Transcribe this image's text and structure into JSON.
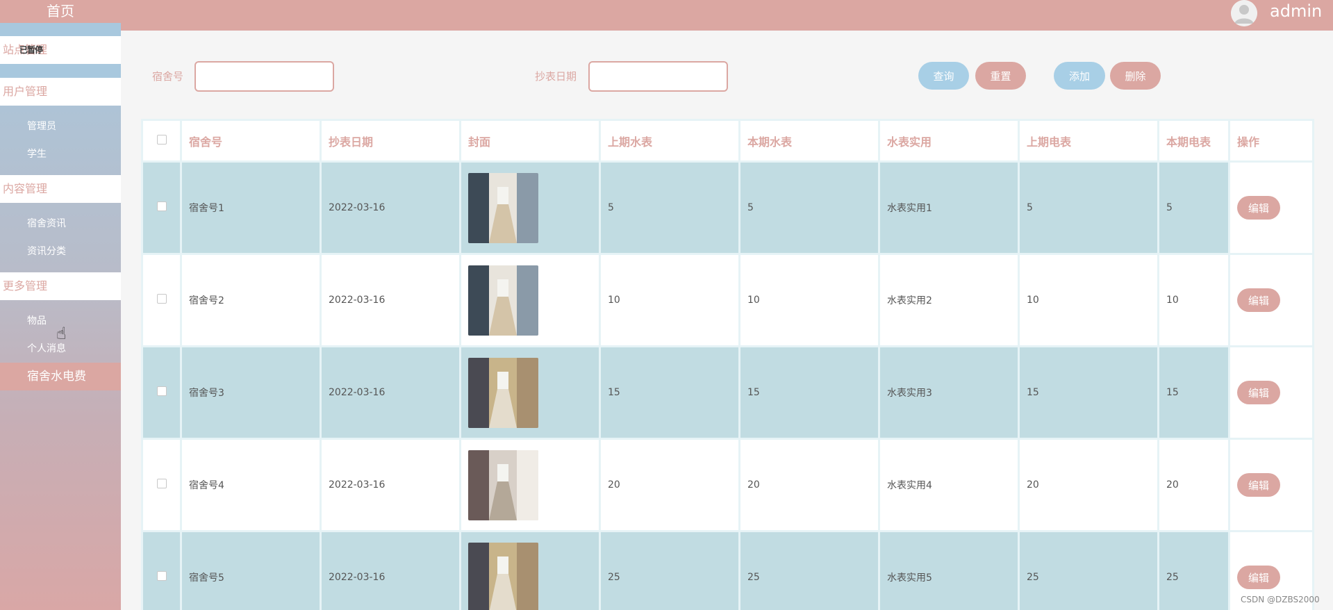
{
  "sidebar": {
    "home": "首页",
    "groups": [
      {
        "label": "站点管理",
        "overlap_text": "已暂停"
      },
      {
        "label": "用户管理",
        "items": [
          "管理员",
          "学生"
        ]
      },
      {
        "label": "内容管理",
        "items": [
          "宿舍资讯",
          "资讯分类"
        ]
      },
      {
        "label": "更多管理",
        "items": [
          "物品",
          "个人消息",
          "宿舍水电费"
        ]
      }
    ],
    "active_item": "宿舍水电费"
  },
  "header": {
    "username": "admin",
    "avatar_icon": "user-avatar-icon"
  },
  "search": {
    "dorm_label": "宿舍号",
    "date_label": "抄表日期",
    "dorm_placeholder": "",
    "date_placeholder": "",
    "query_button": "查询",
    "reset_button": "重置",
    "add_button": "添加",
    "delete_button": "删除"
  },
  "table": {
    "columns": [
      "宿舍号",
      "抄表日期",
      "封面",
      "上期水表",
      "本期水表",
      "水表实用",
      "上期电表",
      "本期电表",
      "操作"
    ],
    "rows": [
      {
        "dorm": "宿舍号1",
        "date": "2022-03-16",
        "prev_water": "5",
        "curr_water": "5",
        "water_used": "水表实用1",
        "prev_elec": "5",
        "curr_elec": "5",
        "action": "编辑",
        "image": "dorm-room-photo"
      },
      {
        "dorm": "宿舍号2",
        "date": "2022-03-16",
        "prev_water": "10",
        "curr_water": "10",
        "water_used": "水表实用2",
        "prev_elec": "10",
        "curr_elec": "10",
        "action": "编辑",
        "image": "dorm-room-photo"
      },
      {
        "dorm": "宿舍号3",
        "date": "2022-03-16",
        "prev_water": "15",
        "curr_water": "15",
        "water_used": "水表实用3",
        "prev_elec": "15",
        "curr_elec": "15",
        "action": "编辑",
        "image": "dorm-hallway-photo"
      },
      {
        "dorm": "宿舍号4",
        "date": "2022-03-16",
        "prev_water": "20",
        "curr_water": "20",
        "water_used": "水表实用4",
        "prev_elec": "20",
        "curr_elec": "20",
        "action": "编辑",
        "image": "corridor-photo"
      },
      {
        "dorm": "宿舍号5",
        "date": "2022-03-16",
        "prev_water": "25",
        "curr_water": "25",
        "water_used": "水表实用5",
        "prev_elec": "25",
        "curr_elec": "25",
        "action": "编辑",
        "image": "dorm-hallway-photo"
      }
    ]
  },
  "watermark": "CSDN @DZBS2000",
  "colors": {
    "accent_pink": "#dba7a2",
    "accent_blue": "#a8cfe6",
    "row_teal": "#c1dce2"
  }
}
